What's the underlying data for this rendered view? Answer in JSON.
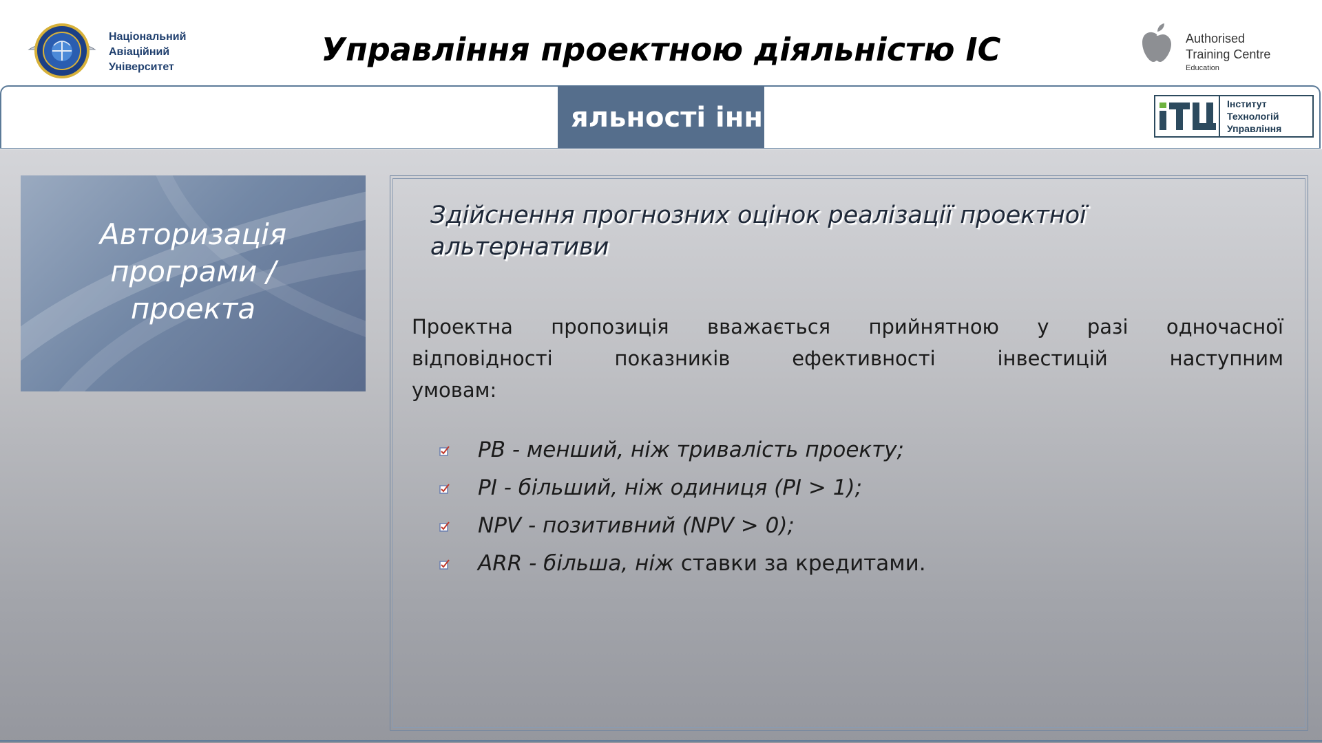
{
  "header": {
    "university_name": [
      "Національний",
      "Авіаційний",
      "Університет"
    ],
    "title": "Управління проектною діяльністю ІС",
    "atc": {
      "line1": "Authorised",
      "line2": "Training Centre",
      "line3": "Education"
    }
  },
  "band": {
    "marquee_text": "яльності інн",
    "itu_label": [
      "Інститут",
      "Технологій",
      "Управління"
    ]
  },
  "side_panel": {
    "title_lines": [
      "Авторизація",
      "програми /",
      "проекта"
    ]
  },
  "content": {
    "heading_lines": [
      "Здійснення прогнозних оцінок реалізації проектної",
      "альтернативи"
    ],
    "paragraph_lines": [
      "Проектна пропозиція вважається прийнятною у разі одночасної",
      "відповідності показників ефективності інвестицій наступним",
      "умовам:"
    ],
    "criteria": [
      {
        "italic": "PB - менший, ніж тривалість проекту;",
        "normal": ""
      },
      {
        "italic": "PI - більший, ніж одиниця (PI > 1);",
        "normal": ""
      },
      {
        "italic": "NPV - позитивний (NPV > 0);",
        "normal": ""
      },
      {
        "italic": "ARR - більша, ніж",
        "normal": " ставки за кредитами."
      }
    ]
  },
  "colors": {
    "frame_border": "#5b7a98",
    "marquee_bg": "#556e8c",
    "check_box": "#6a7fb0",
    "check_mark": "#c0392b"
  },
  "icons": {
    "university_logo": "nau-emblem-icon",
    "apple_logo": "apple-icon",
    "itu_logo": "itu-logo-icon",
    "bullet": "checkbox-checked-icon"
  }
}
